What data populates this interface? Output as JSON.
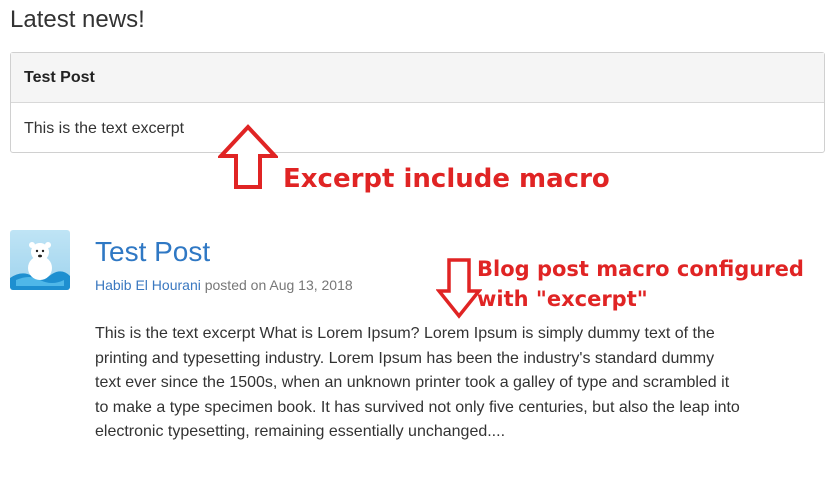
{
  "heading": "Latest news!",
  "include_panel": {
    "title": "Test Post",
    "excerpt": "This is the text excerpt"
  },
  "annotations": {
    "excerpt_include": "Excerpt include macro",
    "blog_post_line1": "Blog post macro configured",
    "blog_post_line2": "with \"excerpt\"",
    "color": "#e02424"
  },
  "post": {
    "avatar_icon": "polar-bear-avatar-icon",
    "title": "Test Post",
    "author": "Habib El Hourani",
    "posted_on": "posted on",
    "date": "Aug 13, 2018",
    "body_lines": [
      "This is the text excerpt What is Lorem Ipsum? Lorem Ipsum is simply dummy text of the",
      "printing and typesetting industry. Lorem Ipsum has been the industry's standard dummy",
      "text ever since the 1500s, when an unknown printer took a galley of type and scrambled it",
      "to make a type specimen book. It has survived not only five centuries, but also the leap into",
      "electronic typesetting, remaining essentially unchanged...."
    ]
  }
}
